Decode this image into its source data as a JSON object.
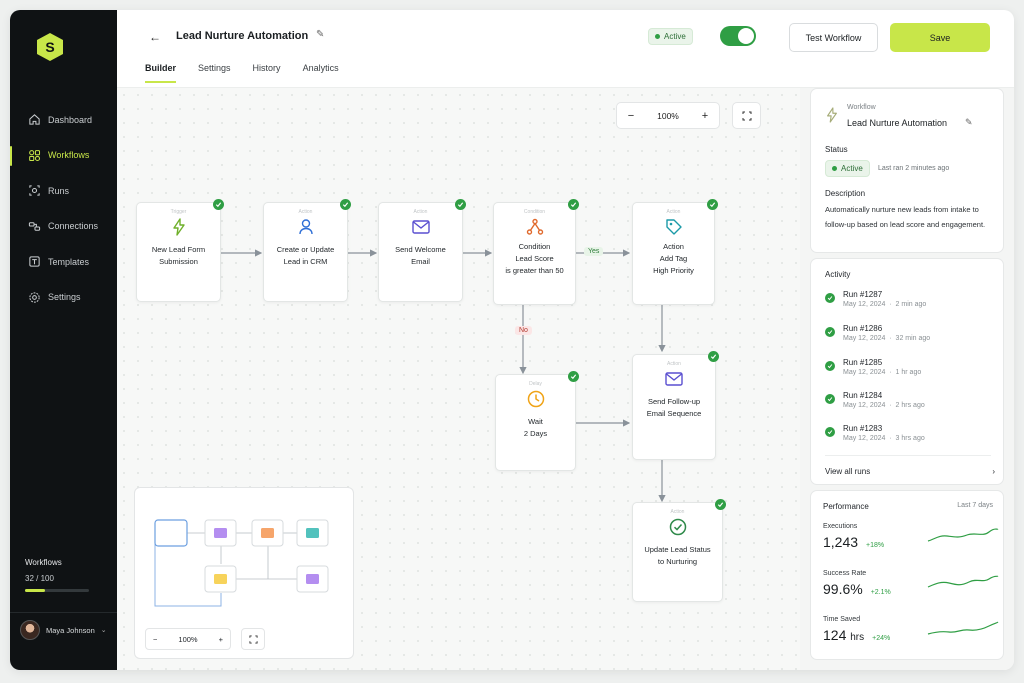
{
  "sidebar": {
    "items": [
      {
        "label": "Dashboard",
        "icon": "home-icon"
      },
      {
        "label": "Workflows",
        "icon": "workflows-icon",
        "active": true
      },
      {
        "label": "Runs",
        "icon": "runs-icon"
      },
      {
        "label": "Connections",
        "icon": "connections-icon"
      },
      {
        "label": "Templates",
        "icon": "templates-icon"
      },
      {
        "label": "Settings",
        "icon": "gear-icon"
      }
    ],
    "usage": {
      "title": "Workflows",
      "count": "32 / 100",
      "fraction": 0.32
    },
    "user": {
      "name": "Maya Johnson"
    }
  },
  "header": {
    "title": "Lead Nurture Automation",
    "status": "Active",
    "toggle_on": true,
    "test_label": "Test Workflow",
    "save_label": "Save",
    "tabs": [
      "Builder",
      "Settings",
      "History",
      "Analytics"
    ]
  },
  "canvas": {
    "zoom": "100%",
    "nodes": {
      "trigger": {
        "caption": "Trigger",
        "label": "New Lead Form\nSubmission"
      },
      "crm": {
        "caption": "Action",
        "label": "Create or Update\nLead in CRM"
      },
      "email": {
        "caption": "Action",
        "label": "Send Welcome\nEmail"
      },
      "condition": {
        "caption": "Condition",
        "label": "Condition\nLead Score\nis greater than 50"
      },
      "tag": {
        "caption": "Action",
        "label": "Action\nAdd Tag\nHigh Priority"
      },
      "wait": {
        "caption": "Delay",
        "label": "Wait\n2 Days"
      },
      "followup": {
        "caption": "Action",
        "label": "Send Follow-up\nEmail Sequence"
      },
      "status": {
        "caption": "Action",
        "label": "Update Lead Status\nto Nurturing"
      }
    },
    "edge_yes": "Yes",
    "edge_no": "No",
    "minimap_zoom": "100%"
  },
  "details": {
    "caption": "Workflow",
    "name": "Lead Nurture Automation",
    "status_label": "Status",
    "status": "Active",
    "last_ran": "Last ran 2 minutes ago",
    "description_label": "Description",
    "description": "Automatically nurture new leads from intake to follow-up based on lead score and engagement."
  },
  "activity": {
    "title": "Activity",
    "runs": [
      {
        "id": "Run #1287",
        "date": "May 12, 2024",
        "ago": "2 min ago"
      },
      {
        "id": "Run #1286",
        "date": "May 12, 2024",
        "ago": "32 min ago"
      },
      {
        "id": "Run #1285",
        "date": "May 12, 2024",
        "ago": "1 hr ago"
      },
      {
        "id": "Run #1284",
        "date": "May 12, 2024",
        "ago": "2 hrs ago"
      },
      {
        "id": "Run #1283",
        "date": "May 12, 2024",
        "ago": "3 hrs ago"
      }
    ],
    "view_all": "View all runs"
  },
  "performance": {
    "title": "Performance",
    "range": "Last 7 days",
    "metrics": [
      {
        "label": "Executions",
        "value": "1,243",
        "unit": "",
        "delta": "+18%"
      },
      {
        "label": "Success Rate",
        "value": "99.6%",
        "unit": "",
        "delta": "+2.1%"
      },
      {
        "label": "Time Saved",
        "value": "124",
        "unit": "hrs",
        "delta": "+24%"
      }
    ],
    "colors": {
      "accent": "#c8e649",
      "success": "#2f9e44"
    }
  }
}
